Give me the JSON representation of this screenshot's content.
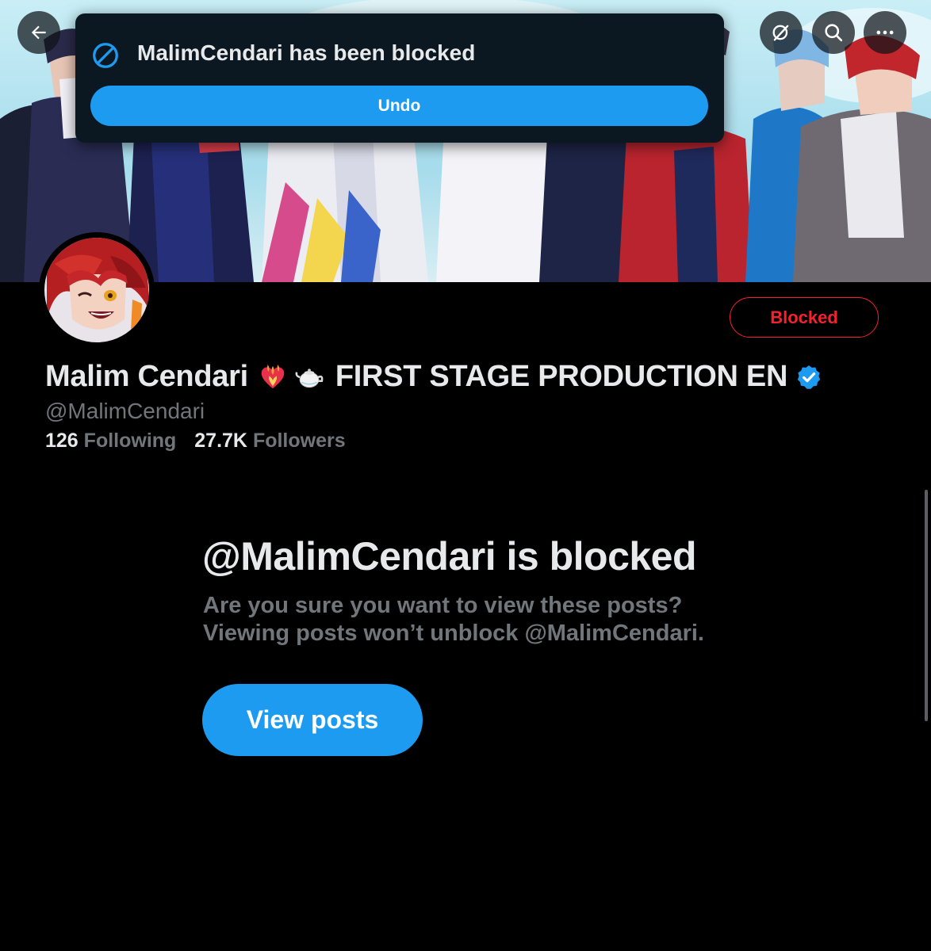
{
  "toast": {
    "message": "MalimCendari has been blocked",
    "undo_label": "Undo",
    "icon": "block-icon"
  },
  "nav": {
    "back_icon": "arrow-left-icon",
    "grok_icon": "grok-icon",
    "search_icon": "search-icon",
    "more_icon": "more-icon"
  },
  "profile": {
    "name_part1": "Malim Cendari",
    "name_part2": "FIRST STAGE PRODUCTION EN",
    "emojis": [
      "heart-on-fire-emoji",
      "teapot-emoji"
    ],
    "handle": "@MalimCendari",
    "following_count": "126",
    "following_label": "Following",
    "followers_count": "27.7K",
    "followers_label": "Followers",
    "blocked_button_label": "Blocked",
    "verified_badge": "verified-badge-icon"
  },
  "blocked_notice": {
    "title": "@MalimCendari is blocked",
    "line1": "Are you sure you want to view these posts?",
    "line2": "Viewing posts won’t unblock @MalimCendari.",
    "view_posts_label": "View posts"
  },
  "colors": {
    "accent": "#1d9bf0",
    "danger": "#f4212e",
    "background": "#000000",
    "secondary_text": "#71767b",
    "primary_text": "#e7e9ea",
    "toast_background": "#0b1821"
  }
}
